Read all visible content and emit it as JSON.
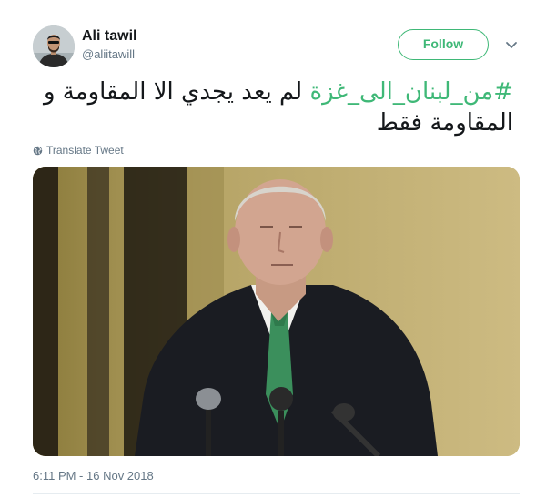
{
  "author": {
    "name": "Ali tawil",
    "handle": "@aliitawill"
  },
  "actions": {
    "follow_label": "Follow"
  },
  "tweet": {
    "hashtag": "#من_لبنان_الى_غزة",
    "text_rest": " لم يعد يجدي الا المقاومة و المقاومة فقط",
    "translate_label": "Translate Tweet",
    "timestamp": "6:11 PM - 16 Nov 2018"
  },
  "colors": {
    "accent": "#3fb877",
    "secondary_text": "#657786",
    "primary_text": "#14171a"
  },
  "icons": {
    "menu": "chevron-down-icon",
    "translate": "globe-icon"
  }
}
